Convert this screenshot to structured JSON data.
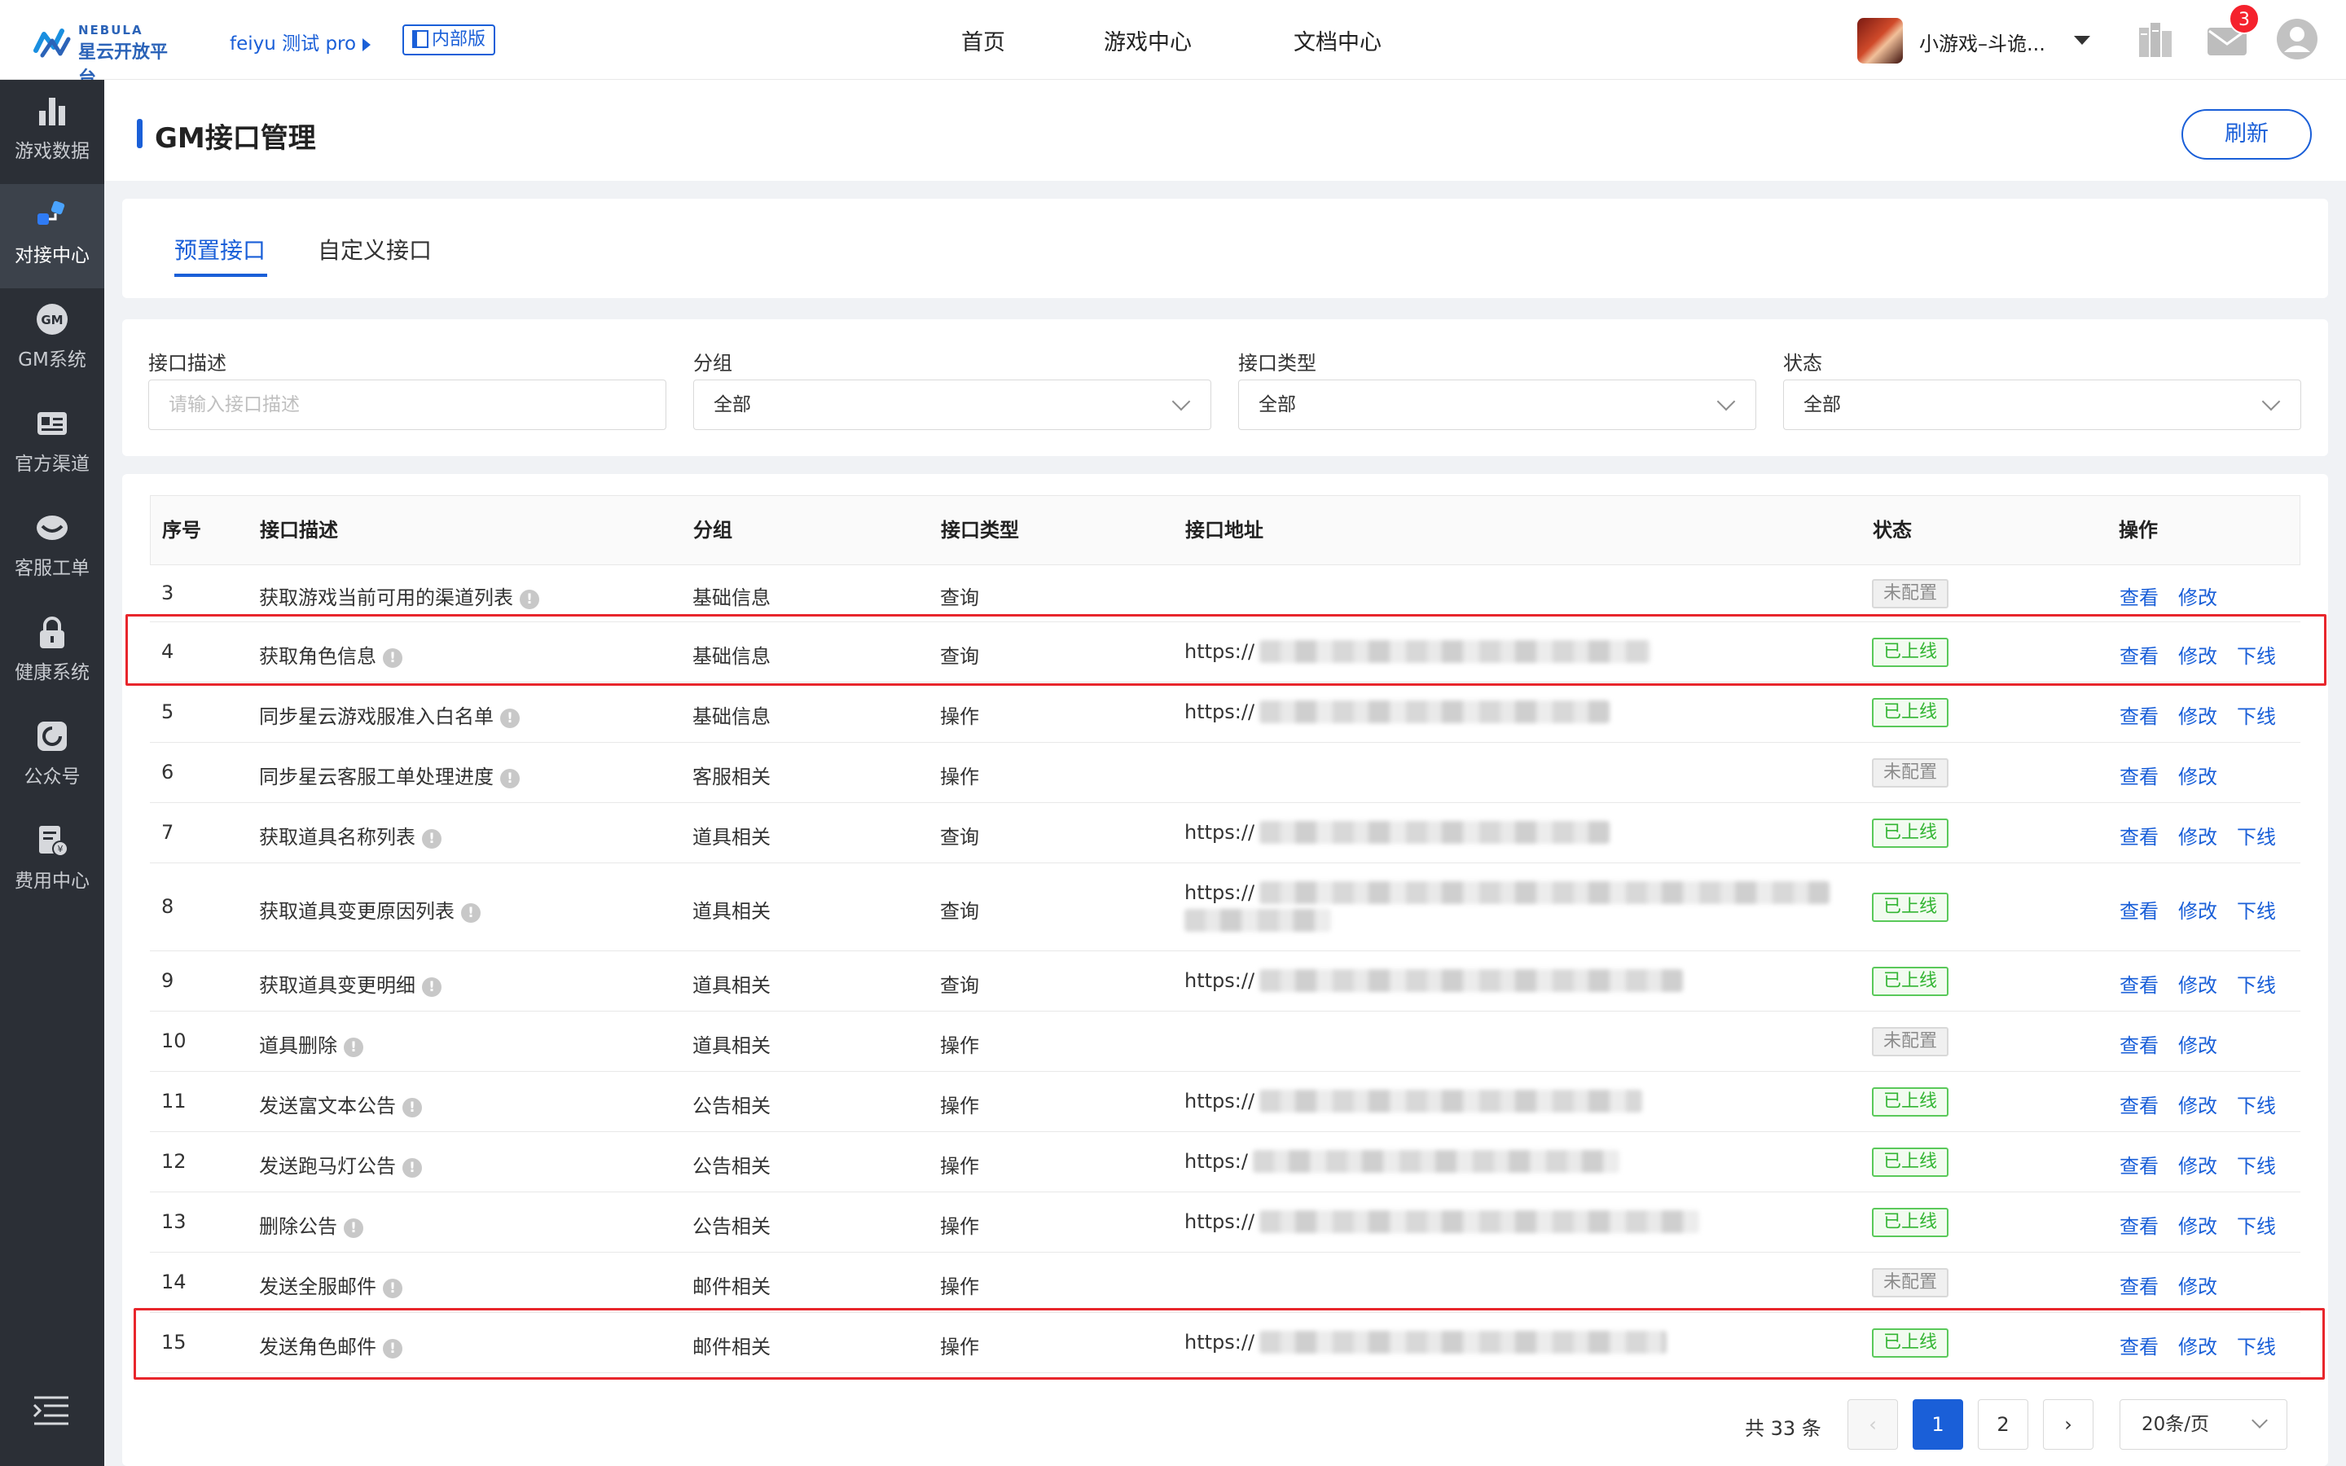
{
  "header": {
    "logo_en": "NEBULA",
    "logo_cn": "星云开放平台",
    "project": "feiyu 测试 pro",
    "internal_badge": "内部版",
    "nav": [
      "首页",
      "游戏中心",
      "文档中心"
    ],
    "game_name": "小游戏–斗诡...",
    "mail_count": "3"
  },
  "sidebar": [
    {
      "label": "游戏数据",
      "icon": "bar-chart-icon"
    },
    {
      "label": "对接中心",
      "icon": "integration-icon",
      "active": true
    },
    {
      "label": "GM系统",
      "icon": "gm-icon"
    },
    {
      "label": "官方渠道",
      "icon": "id-card-icon"
    },
    {
      "label": "客服工单",
      "icon": "customer-service-icon"
    },
    {
      "label": "健康系统",
      "icon": "lock-icon"
    },
    {
      "label": "公众号",
      "icon": "official-account-icon"
    },
    {
      "label": "费用中心",
      "icon": "billing-icon"
    }
  ],
  "page": {
    "title": "GM接口管理",
    "refresh": "刷新"
  },
  "tabs": [
    "预置接口",
    "自定义接口"
  ],
  "filters": {
    "desc_label": "接口描述",
    "desc_placeholder": "请输入接口描述",
    "group_label": "分组",
    "group_value": "全部",
    "type_label": "接口类型",
    "type_value": "全部",
    "status_label": "状态",
    "status_value": "全部"
  },
  "table": {
    "headers": [
      "序号",
      "接口描述",
      "分组",
      "接口类型",
      "接口地址",
      "状态",
      "操作"
    ],
    "rows": [
      {
        "no": "3",
        "desc": "获取游戏当前可用的渠道列表",
        "group": "基础信息",
        "type": "查询",
        "url": "",
        "status": "未配置",
        "ops": [
          "查看",
          "修改"
        ]
      },
      {
        "no": "4",
        "desc": "获取角色信息",
        "group": "基础信息",
        "type": "查询",
        "url": "https://",
        "status": "已上线",
        "ops": [
          "查看",
          "修改",
          "下线"
        ]
      },
      {
        "no": "5",
        "desc": "同步星云游戏服准入白名单",
        "group": "基础信息",
        "type": "操作",
        "url": "https://",
        "status": "已上线",
        "ops": [
          "查看",
          "修改",
          "下线"
        ]
      },
      {
        "no": "6",
        "desc": "同步星云客服工单处理进度",
        "group": "客服相关",
        "type": "操作",
        "url": "",
        "status": "未配置",
        "ops": [
          "查看",
          "修改"
        ]
      },
      {
        "no": "7",
        "desc": "获取道具名称列表",
        "group": "道具相关",
        "type": "查询",
        "url": "https://",
        "status": "已上线",
        "ops": [
          "查看",
          "修改",
          "下线"
        ]
      },
      {
        "no": "8",
        "desc": "获取道具变更原因列表",
        "group": "道具相关",
        "type": "查询",
        "url": "https://",
        "status": "已上线",
        "ops": [
          "查看",
          "修改",
          "下线"
        ]
      },
      {
        "no": "9",
        "desc": "获取道具变更明细",
        "group": "道具相关",
        "type": "查询",
        "url": "https://",
        "status": "已上线",
        "ops": [
          "查看",
          "修改",
          "下线"
        ]
      },
      {
        "no": "10",
        "desc": "道具删除",
        "group": "道具相关",
        "type": "操作",
        "url": "",
        "status": "未配置",
        "ops": [
          "查看",
          "修改"
        ]
      },
      {
        "no": "11",
        "desc": "发送富文本公告",
        "group": "公告相关",
        "type": "操作",
        "url": "https://",
        "status": "已上线",
        "ops": [
          "查看",
          "修改",
          "下线"
        ]
      },
      {
        "no": "12",
        "desc": "发送跑马灯公告",
        "group": "公告相关",
        "type": "操作",
        "url": "https:/",
        "status": "已上线",
        "ops": [
          "查看",
          "修改",
          "下线"
        ]
      },
      {
        "no": "13",
        "desc": "删除公告",
        "group": "公告相关",
        "type": "操作",
        "url": "https://",
        "status": "已上线",
        "ops": [
          "查看",
          "修改",
          "下线"
        ]
      },
      {
        "no": "14",
        "desc": "发送全服邮件",
        "group": "邮件相关",
        "type": "操作",
        "url": "",
        "status": "未配置",
        "ops": [
          "查看",
          "修改"
        ]
      },
      {
        "no": "15",
        "desc": "发送角色邮件",
        "group": "邮件相关",
        "type": "操作",
        "url": "https://",
        "status": "已上线",
        "ops": [
          "查看",
          "修改",
          "下线"
        ]
      }
    ]
  },
  "pagination": {
    "total": "共 33 条",
    "pages": [
      "1",
      "2"
    ],
    "current": "1",
    "page_size": "20条/页",
    "prev": "‹",
    "next": "›"
  },
  "colors": {
    "primary": "#1a5fd8",
    "online": "#33b533",
    "highlight": "#e8262c"
  }
}
